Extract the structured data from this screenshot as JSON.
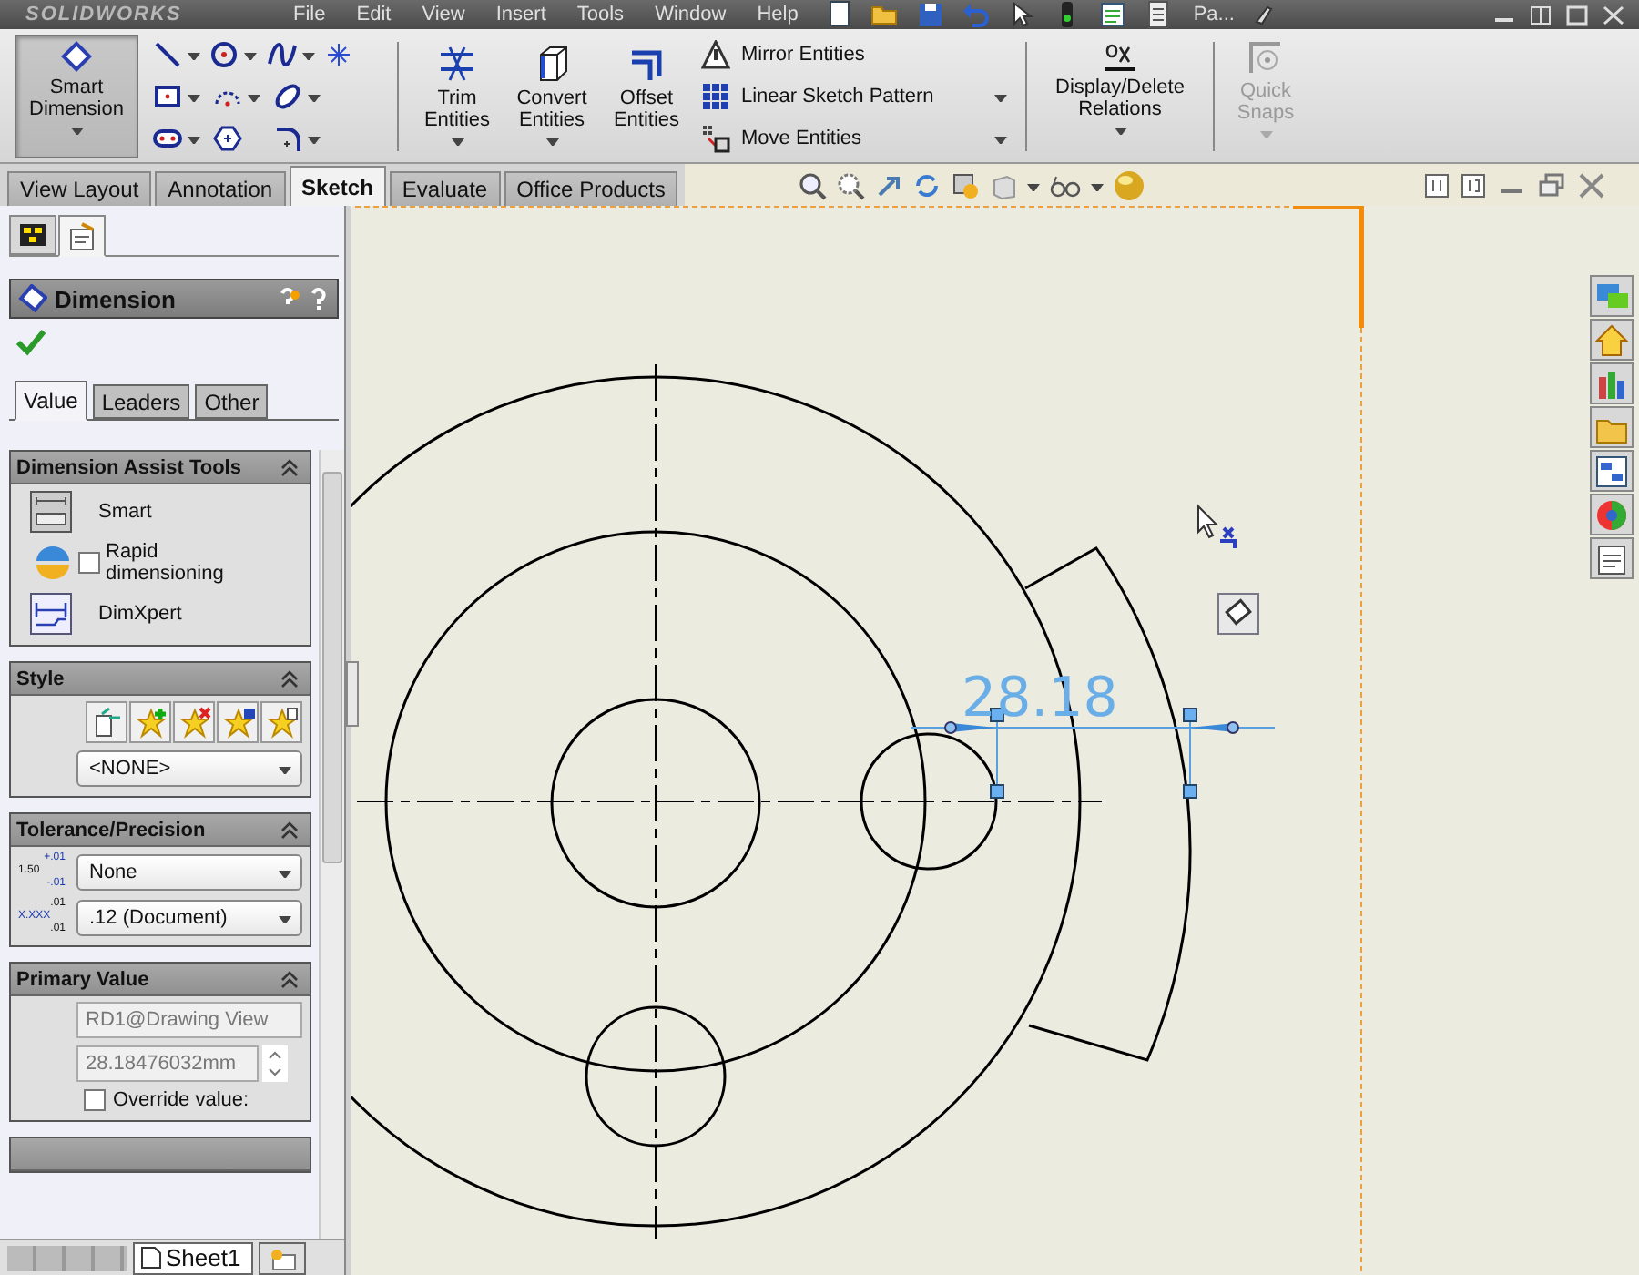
{
  "title_bar": {
    "logo": "SOLIDWORKS",
    "menu": [
      "File",
      "Edit",
      "View",
      "Insert",
      "Tools",
      "Window",
      "Help"
    ],
    "document": "Pa..."
  },
  "command_manager": {
    "smart_dimension": {
      "label": "Smart Dimension",
      "selected": true
    },
    "big_tools": [
      {
        "label": "Trim Entities",
        "kind": "trim",
        "dropdown": true
      },
      {
        "label": "Convert Entities",
        "kind": "convert",
        "dropdown": true
      },
      {
        "label": "Offset Entities",
        "kind": "offset",
        "dropdown": false
      }
    ],
    "small_tools": [
      {
        "label": "Mirror Entities",
        "kind": "mirror",
        "dropdown": false
      },
      {
        "label": "Linear Sketch Pattern",
        "kind": "pattern",
        "dropdown": true
      },
      {
        "label": "Move Entities",
        "kind": "move",
        "dropdown": true
      }
    ],
    "relations": {
      "label": "Display/Delete Relations"
    },
    "quick_snaps": {
      "label": "Quick Snaps",
      "disabled": true
    }
  },
  "tabs": [
    {
      "label": "View Layout",
      "selected": false
    },
    {
      "label": "Annotation",
      "selected": false
    },
    {
      "label": "Sketch",
      "selected": true
    },
    {
      "label": "Evaluate",
      "selected": false
    },
    {
      "label": "Office Products",
      "selected": false
    }
  ],
  "property_manager": {
    "panel_tabs": [
      {
        "kind": "tree",
        "selected": false
      },
      {
        "kind": "properties",
        "selected": true
      }
    ],
    "title": "Dimension",
    "tabs": [
      {
        "label": "Value",
        "selected": true
      },
      {
        "label": "Leaders",
        "selected": false
      },
      {
        "label": "Other",
        "selected": false
      }
    ],
    "sections": [
      {
        "title": "Dimension Assist Tools",
        "rows": [
          {
            "kind": "smart",
            "label": "Smart"
          },
          {
            "kind": "rapid",
            "label": "Rapid dimensioning",
            "checked": false
          },
          {
            "kind": "dimxpert",
            "label": "DimXpert"
          }
        ]
      },
      {
        "title": "Style",
        "rows": [
          {
            "kind": "style_buttons"
          },
          {
            "kind": "dropdown",
            "value": "<NONE>"
          }
        ]
      },
      {
        "title": "Tolerance/Precision",
        "rows": [
          {
            "kind": "tolerance",
            "icon_text": [
              "+.01",
              "1.50",
              "-.01"
            ],
            "value": "None"
          },
          {
            "kind": "precision",
            "icon_text": [
              ".01",
              "X.XXX",
              ".01"
            ],
            "value": ".12 (Document)"
          }
        ]
      },
      {
        "title": "Primary Value",
        "rows": [
          {
            "kind": "name_field",
            "value": "RD1@Drawing View",
            "disabled": true
          },
          {
            "kind": "spin_field",
            "value": "28.18476032mm",
            "disabled": true
          },
          {
            "kind": "checkbox",
            "label": "Override value:",
            "checked": false
          }
        ]
      }
    ]
  },
  "sheet_tabs": [
    {
      "label": "Sheet1",
      "selected": true
    }
  ],
  "drawing": {
    "dimension": "28.18"
  }
}
